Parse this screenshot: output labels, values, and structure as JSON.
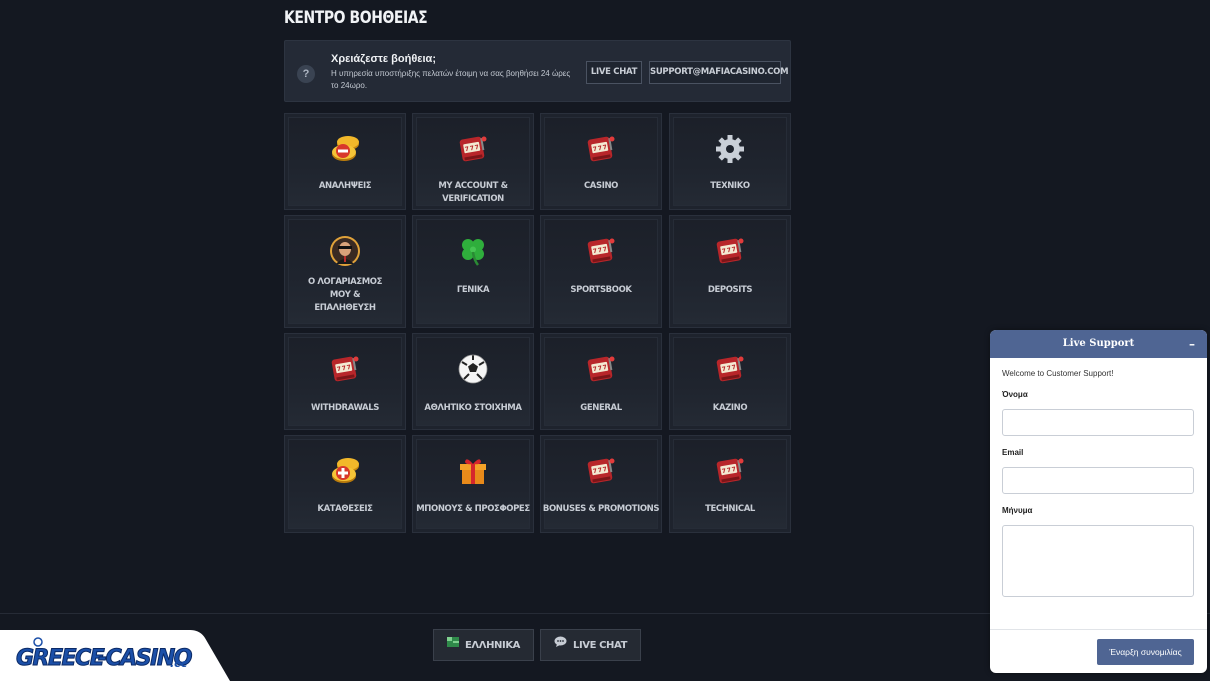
{
  "page_title": "ΚΕΝΤΡΟ ΒΟΗΘΕΙΑΣ",
  "help_banner": {
    "icon": "question-icon",
    "heading": "Χρειάζεστε βοήθεια;",
    "text": "Η υπηρεσία υποστήριξης πελατών έτοιμη να σας βοηθήσει 24 ώρες το 24ωρο.",
    "live_chat_label": "LIVE CHAT",
    "email_label": "SUPPORT@MAFIACASINO.COM"
  },
  "categories": [
    {
      "label": "ΑΝΑΛΗΨΕΙΣ",
      "icon": "coins-minus-icon"
    },
    {
      "label": "MY ACCOUNT & VERIFICATION",
      "icon": "slot-machine-icon"
    },
    {
      "label": "CASINO",
      "icon": "slot-machine-icon"
    },
    {
      "label": "ΤΕΧΝΙΚΟ",
      "icon": "gear-icon"
    },
    {
      "label": "Ο ΛΟΓΑΡΙΑΣΜΟΣ ΜΟΥ & ΕΠΑΛΗΘΕΥΣΗ",
      "icon": "mafioso-avatar-icon"
    },
    {
      "label": "ΓΕΝΙΚΑ",
      "icon": "clover-icon"
    },
    {
      "label": "SPORTSBOOK",
      "icon": "slot-machine-icon"
    },
    {
      "label": "DEPOSITS",
      "icon": "slot-machine-icon"
    },
    {
      "label": "WITHDRAWALS",
      "icon": "slot-machine-icon"
    },
    {
      "label": "ΑΘΛΗΤΙΚΟ ΣΤΟΙΧΗΜΑ",
      "icon": "soccer-ball-icon"
    },
    {
      "label": "GENERAL",
      "icon": "slot-machine-icon"
    },
    {
      "label": "ΚΑΖΙΝΟ",
      "icon": "slot-machine-icon"
    },
    {
      "label": "ΚΑΤΑΘΕΣΕΙΣ",
      "icon": "coins-plus-icon"
    },
    {
      "label": "ΜΠΟΝΟΥΣ & ΠΡΟΣΦΟΡΕΣ",
      "icon": "gift-icon"
    },
    {
      "label": "BONUSES & PROMOTIONS",
      "icon": "slot-machine-icon"
    },
    {
      "label": "TECHNICAL",
      "icon": "slot-machine-icon"
    }
  ],
  "footer": {
    "language_label": "ΕΛΛΗΝΙΚΑ",
    "live_chat_label": "LIVE CHAT"
  },
  "logo": {
    "text": "GREECE-CASINO.cc"
  },
  "support_widget": {
    "title": "Live Support",
    "minimize": "–",
    "welcome": "Welcome to Customer Support!",
    "name_label": "Όνομα",
    "email_label": "Email",
    "message_label": "Μήνυμα",
    "start_button": "Έναρξη συνομιλίας"
  }
}
